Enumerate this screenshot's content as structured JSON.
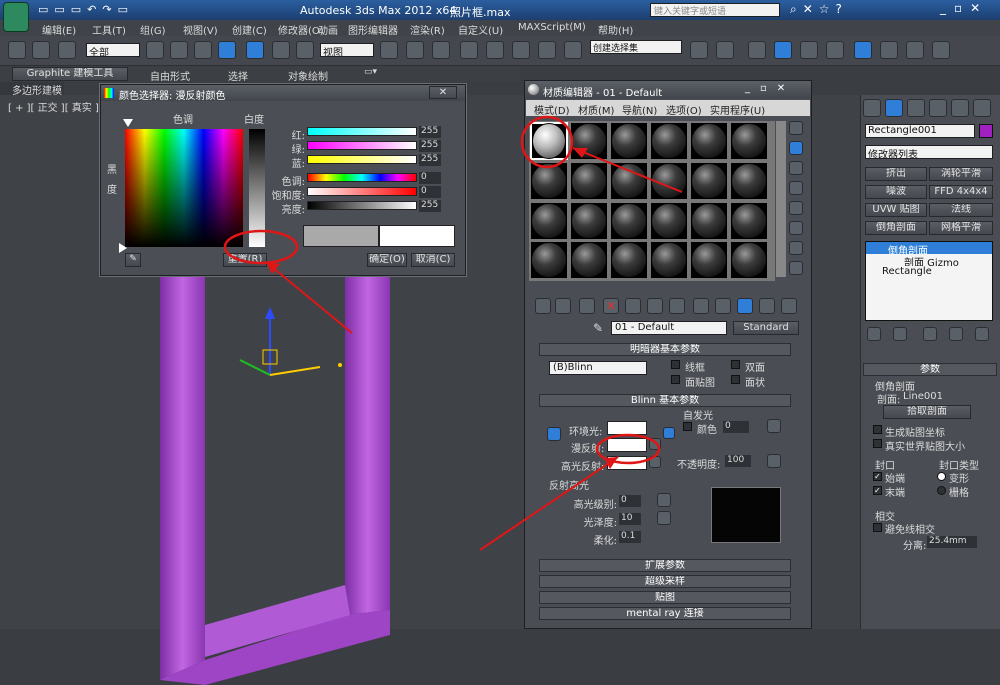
{
  "app": {
    "title": "Autodesk 3ds Max  2012 x64",
    "file": "照片框.max",
    "search_placeholder": "键入关键字或短语"
  },
  "menu": [
    "编辑(E)",
    "工具(T)",
    "组(G)",
    "视图(V)",
    "创建(C)",
    "修改器(O)",
    "动画",
    "图形编辑器",
    "渲染(R)",
    "自定义(U)",
    "MAXScript(M)",
    "帮助(H)"
  ],
  "toolbar": {
    "selection_filter": "全部",
    "ref_coord": "视图",
    "named_selection": "创建选择集"
  },
  "ribbon": {
    "tabs": [
      "Graphite 建模工具",
      "自由形式",
      "选择",
      "对象绘制"
    ],
    "sub": "多边形建模"
  },
  "viewport": {
    "label": "[ + ][ 正交 ][ 真实 ]"
  },
  "color_picker": {
    "title": "颜色选择器: 漫反射颜色",
    "hue_label": "色调",
    "whiteness_label": "白度",
    "black_label": "黑",
    "degree_label": "度",
    "channels": [
      {
        "label": "红:",
        "value": "255"
      },
      {
        "label": "绿:",
        "value": "255"
      },
      {
        "label": "蓝:",
        "value": "255"
      },
      {
        "label": "色调:",
        "value": "0"
      },
      {
        "label": "饱和度:",
        "value": "0"
      },
      {
        "label": "亮度:",
        "value": "255"
      }
    ],
    "reset_button": "重置(R)",
    "ok_button": "确定(O)",
    "cancel_button": "取消(C)"
  },
  "material_editor": {
    "title": "材质编辑器 - 01 - Default",
    "menu": [
      "模式(D)",
      "材质(M)",
      "导航(N)",
      "选项(O)",
      "实用程序(U)"
    ],
    "material_name": "01 - Default",
    "material_type": "Standard",
    "shader_rollout": "明暗器基本参数",
    "shader": "(B)Blinn",
    "wire": "线框",
    "two_sided": "双面",
    "face_map": "面贴图",
    "faceted": "面状",
    "blinn_rollout": "Blinn 基本参数",
    "self_illum": "自发光",
    "color_label": "颜色",
    "self_illum_value": "0",
    "ambient": "环境光:",
    "diffuse": "漫反射:",
    "specular": "高光反射:",
    "opacity_label": "不透明度:",
    "opacity_value": "100",
    "spec_highlights": "反射高光",
    "spec_level_label": "高光级别:",
    "spec_level_value": "0",
    "glossiness_label": "光泽度:",
    "glossiness_value": "10",
    "soften_label": "柔化:",
    "soften_value": "0.1",
    "collapsed_rollouts": [
      "扩展参数",
      "超级采样",
      "贴图",
      "mental ray 连接"
    ]
  },
  "command_panel": {
    "object_name": "Rectangle001",
    "modifier_list": "修改器列表",
    "buttons": [
      "挤出",
      "涡轮平滑",
      "噪波",
      "FFD 4x4x4",
      "UVW 贴图",
      "法线",
      "倒角剖面",
      "网格平滑"
    ],
    "stack": [
      "倒角剖面",
      "剖面 Gizmo",
      "Rectangle"
    ],
    "params_title": "参数",
    "bevel_profile": "倒角剖面",
    "profile_label": "剖面:",
    "profile_value": "Line001",
    "pick_profile": "拾取剖面",
    "gen_mapping": "生成贴图坐标",
    "real_world": "真实世界贴图大小",
    "capping": "封口",
    "start": "始端",
    "end": "末端",
    "cap_type": "封口类型",
    "morph": "变形",
    "grid": "栅格",
    "intersections": "相交",
    "avoid_intersect": "避免线相交",
    "separation_label": "分离:",
    "separation_value": "25.4mm"
  },
  "colors": {
    "frame": "#a347c9",
    "accent": "#2f7fd8",
    "annotation": "#e01616",
    "object_swatch": "#a020c0"
  }
}
